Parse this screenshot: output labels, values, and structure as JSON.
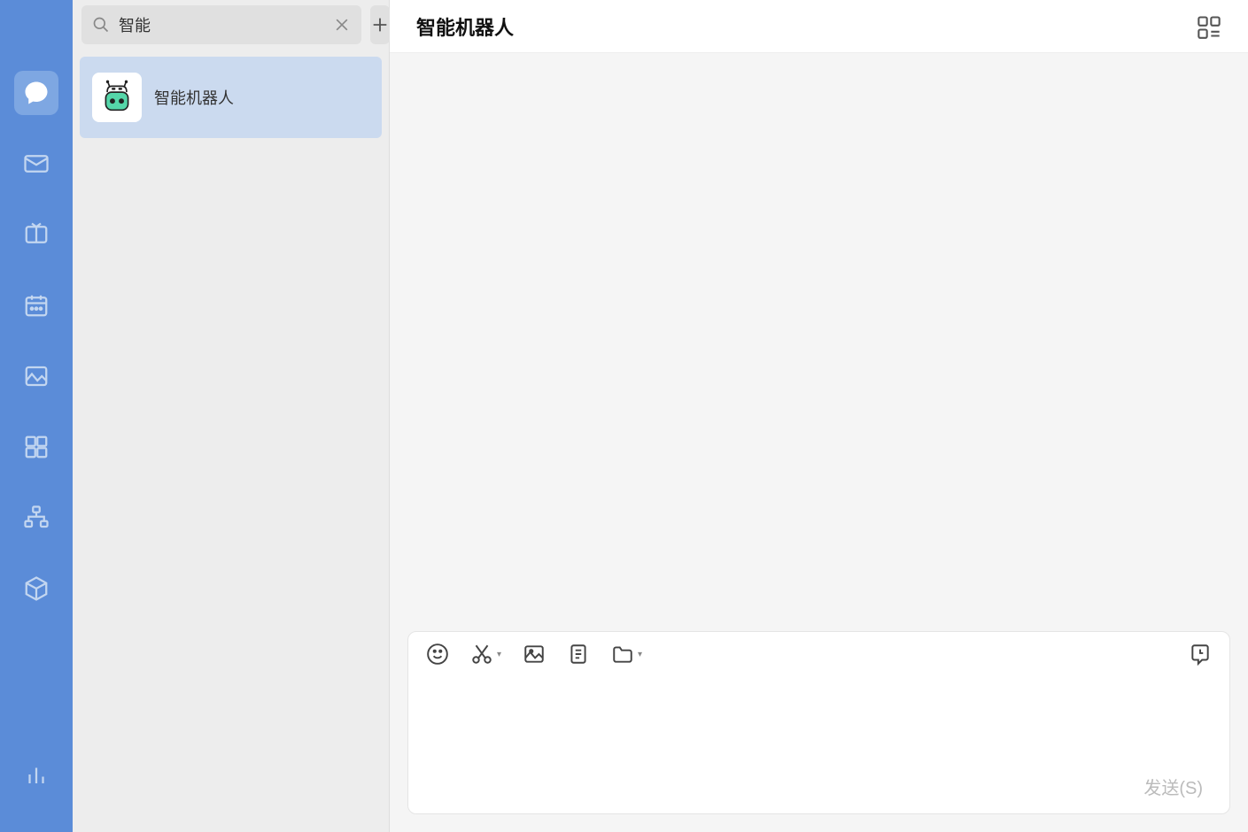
{
  "nav": {
    "items": [
      {
        "name": "chat",
        "active": true
      },
      {
        "name": "mail",
        "active": false
      },
      {
        "name": "workspace",
        "active": false
      },
      {
        "name": "calendar",
        "active": false
      },
      {
        "name": "images",
        "active": false
      },
      {
        "name": "apps",
        "active": false
      },
      {
        "name": "org",
        "active": false
      },
      {
        "name": "cube",
        "active": false
      }
    ],
    "bottom": {
      "name": "stats"
    }
  },
  "search": {
    "value": "智能"
  },
  "chat_list": [
    {
      "name": "智能机器人",
      "selected": true
    }
  ],
  "main": {
    "title": "智能机器人"
  },
  "composer": {
    "send_label": "发送(S)"
  }
}
